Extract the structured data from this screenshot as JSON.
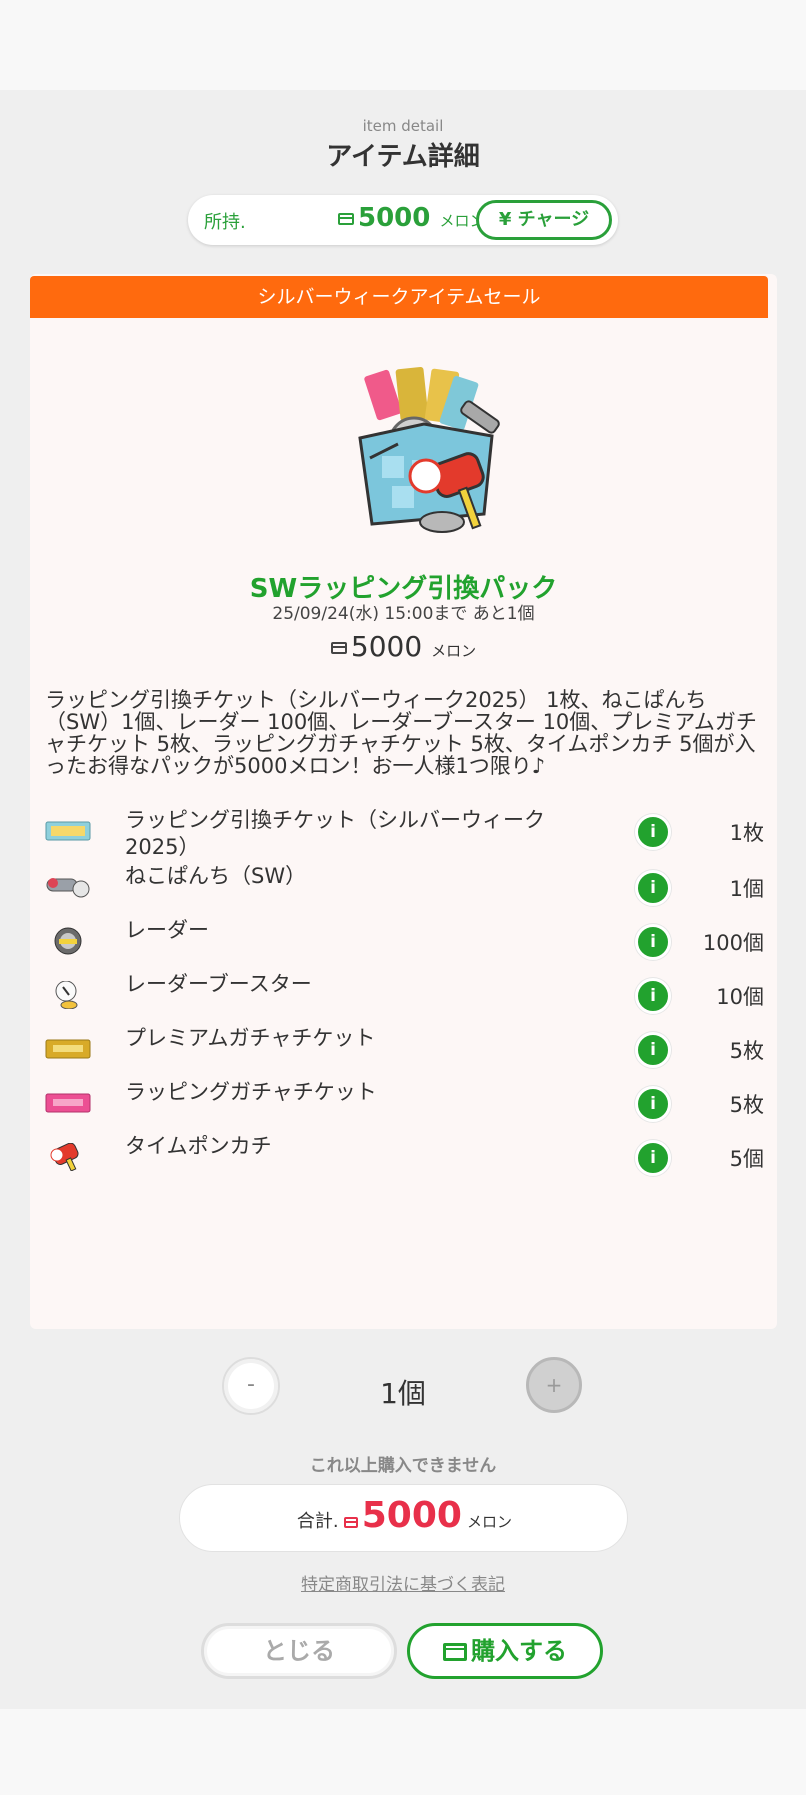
{
  "header": {
    "subtitle": "item detail",
    "title": "アイテム詳細"
  },
  "wallet": {
    "label": "所持.",
    "amount": "5000",
    "unit": "メロン",
    "charge_label": "¥ チャージ"
  },
  "sale": {
    "banner": "シルバーウィークアイテムセール"
  },
  "item": {
    "name": "SWラッピング引換パック",
    "deadline": "25/09/24(水) 15:00まで あと1個",
    "price": "5000",
    "unit": "メロン",
    "description": "ラッピング引換チケット（シルバーウィーク2025） 1枚、ねこぱんち（SW）1個、レーダー 100個、レーダーブースター 10個、プレミアムガチャチケット 5枚、ラッピングガチャチケット 5枚、タイムポンカチ 5個が入ったお得なパックが5000メロン！お一人様1つ限り♪"
  },
  "contents": [
    {
      "label": "ラッピング引換チケット（シルバーウィーク2025）",
      "qty": "1枚",
      "icon": "wrapping-ticket-icon"
    },
    {
      "label": "ねこぱんち（SW）",
      "qty": "1個",
      "icon": "cat-punch-icon"
    },
    {
      "label": "レーダー",
      "qty": "100個",
      "icon": "radar-icon"
    },
    {
      "label": "レーダーブースター",
      "qty": "10個",
      "icon": "radar-booster-icon"
    },
    {
      "label": "プレミアムガチャチケット",
      "qty": "5枚",
      "icon": "premium-gacha-ticket-icon"
    },
    {
      "label": "ラッピングガチャチケット",
      "qty": "5枚",
      "icon": "wrapping-gacha-ticket-icon"
    },
    {
      "label": "タイムポンカチ",
      "qty": "5個",
      "icon": "time-hammer-icon"
    }
  ],
  "info_label": "i",
  "quantity": {
    "minus": "-",
    "plus": "+",
    "count": "1個"
  },
  "limit_message": "これ以上購入できません",
  "total": {
    "label": "合計.",
    "amount": "5000",
    "unit": "メロン"
  },
  "law_link": "特定商取引法に基づく表記",
  "actions": {
    "close_label": "とじる",
    "buy_label": "購入する"
  },
  "colors": {
    "accent": "#22a22e",
    "banner": "#ff6a0e",
    "price_red": "#e8304a"
  }
}
